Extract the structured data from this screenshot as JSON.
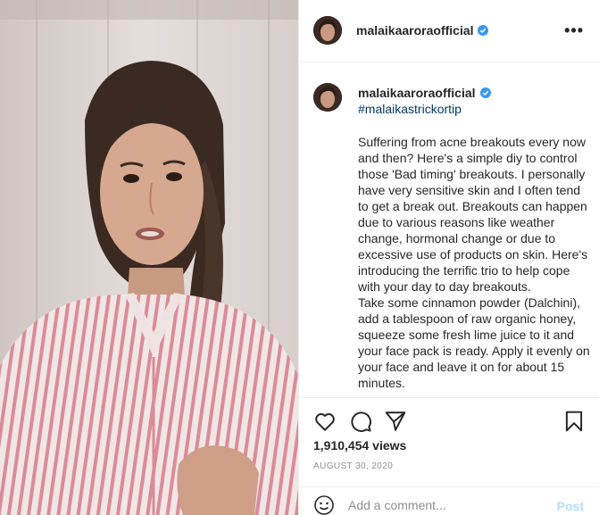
{
  "post": {
    "username": "malaikaaroraofficial",
    "more_label": "•••"
  },
  "caption": {
    "username": "malaikaaroraofficial",
    "hashtag": "#malaikastrickortip",
    "paragraph1": "Suffering from acne breakouts every now and then? Here's a simple diy to control those 'Bad timing' breakouts. I personally have very sensitive skin and I often tend to get a break out. Breakouts can happen due to various reasons like weather change, hormonal change or due to excessive use of products on skin. Here's introducing the terrific trio to help cope with your day to day breakouts.",
    "paragraph2": "Take some cinnamon powder (Dalchini), add a tablespoon of raw organic honey, squeeze some fresh lime juice to it and your face pack is ready. Apply it evenly on your face and leave it on for about 15 minutes."
  },
  "stats": {
    "views": "1,910,454 views",
    "date": "AUGUST 30, 2020"
  },
  "comment": {
    "placeholder": "Add a comment...",
    "post_label": "Post"
  },
  "colors": {
    "verified": "#3897f0",
    "link": "#00376b",
    "post_disabled": "#b2dffc",
    "muted": "#8e8e8e"
  },
  "icons": {
    "like": "heart-icon",
    "comment": "comment-icon",
    "share": "paper-plane-icon",
    "save": "bookmark-icon",
    "emoji": "smiley-icon",
    "verified": "verified-badge-icon",
    "more": "more-options-icon"
  }
}
